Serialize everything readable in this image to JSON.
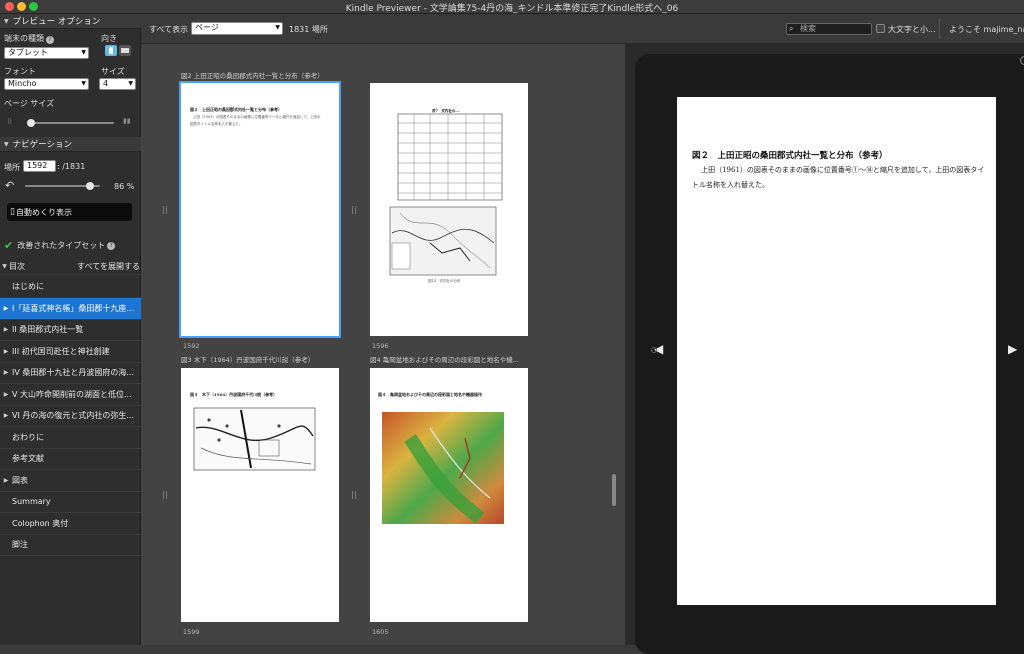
{
  "window": {
    "title": "Kindle Previewer - 文学論集75-4丹の海_キンドル本準修正完了Kindle形式へ_06"
  },
  "sidebar": {
    "preview_header": "プレビュー オプション",
    "device_type_label": "端末の種類",
    "device_type_value": "タブレット",
    "orientation_label": "向き",
    "font_label": "フォント",
    "font_value": "Mincho",
    "size_label": "サイズ",
    "size_value": "4",
    "page_size_label": "ページ サイズ",
    "navigation_header": "ナビゲーション",
    "location_label": "場所",
    "location_value": "1592",
    "location_total": ": /1831",
    "progress_percent": "86 %",
    "progress_fraction": 0.86,
    "auto_flip_label": "自動めくり表示",
    "typeset_label": "改善されたタイプセット",
    "toc_header": "目次",
    "expand_all": "すべてを展開する",
    "toc_items": [
      {
        "label": "はじめに",
        "has_children": false,
        "selected": false
      },
      {
        "label": "I「延喜式神名帳」桑田郡十九座...",
        "has_children": true,
        "selected": true
      },
      {
        "label": "II 桑田郡式内社一覧",
        "has_children": true,
        "selected": false
      },
      {
        "label": "III 初代国司赴任と神社創建",
        "has_children": true,
        "selected": false
      },
      {
        "label": "IV 桑田郡十九社と丹波國府の海...",
        "has_children": true,
        "selected": false
      },
      {
        "label": "V 大山咋命開削前の湖面と低位...",
        "has_children": true,
        "selected": false
      },
      {
        "label": "VI 丹の海の復元と式内社の弥生...",
        "has_children": true,
        "selected": false
      },
      {
        "label": "おわりに",
        "has_children": false,
        "selected": false
      },
      {
        "label": "参考文献",
        "has_children": false,
        "selected": false
      },
      {
        "label": "図表",
        "has_children": true,
        "selected": false
      },
      {
        "label": "Summary",
        "has_children": false,
        "selected": false
      },
      {
        "label": "Colophon 奥付",
        "has_children": false,
        "selected": false
      },
      {
        "label": "脚注",
        "has_children": false,
        "selected": false
      }
    ]
  },
  "toolbar": {
    "show_all_label": "すべて表示",
    "view_mode": "ページ",
    "location_count": "1831 場所",
    "search_placeholder": "検索",
    "case_label": "大文字と小...",
    "welcome": "ようこそ majime_na_"
  },
  "gallery": {
    "thumbs": [
      {
        "caption": "図2 上田正昭の桑田郡式内社一覧と分布（参考）",
        "page": "1592"
      },
      {
        "caption": "",
        "page": "1596"
      },
      {
        "caption": "図3 木下（1964）丹波国府千代川説（参考）",
        "page": "1599"
      },
      {
        "caption": "図4 亀岡盆地およびその周辺の段彩図と地名や機...",
        "page": "1605"
      }
    ],
    "thumb1_title": "図２　上田正昭の桑田郡式内社一覧と分布（参考）",
    "thumb1_text1": "上田（1961）の図表そのままの画像に位置番号①〜⑭と縮尺を追加して，上田の",
    "thumb1_text2": "図表タイトル名称を入れ替えた。",
    "thumb2_title": "表7　式内社の...",
    "thumb2_caption": "図14　式内社の分布",
    "thumb3_title": "図３　木下（1964）丹波国府千代川説（参考）",
    "thumb4_title": "図４　亀岡盆地およびその周辺の段彩図と地名や機器操作"
  },
  "reader": {
    "title": "図２　上田正昭の桑田郡式内社一覧と分布（参考）",
    "body": "上田（1961）の図表そのままの画像に位置番号①〜⑭と縮尺を追加して，上田の図表タイトル名称を入れ替えた。"
  }
}
